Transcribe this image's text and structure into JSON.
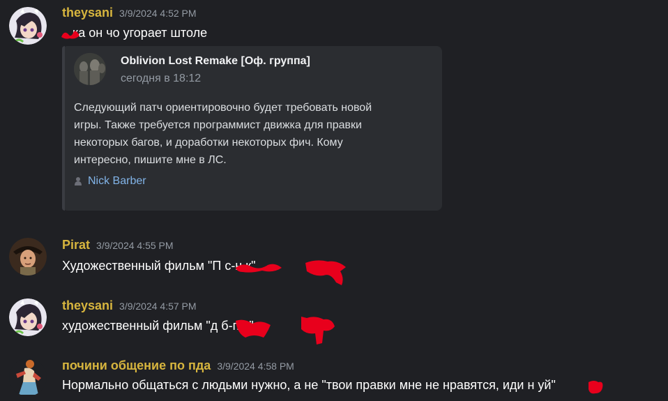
{
  "colors": {
    "background": "#1f2024",
    "username": "#d7b53e",
    "timestamp": "#949ba4",
    "message_text": "#ffffff",
    "embed_bg": "#2b2d31",
    "link": "#82b4e8",
    "redaction": "#e8001c"
  },
  "messages": [
    {
      "username": "theysani",
      "timestamp": "3/9/2024 4:52 PM",
      "text": "ка он чо угорает штоле",
      "embed": {
        "author": "Oblivion Lost Remake [Оф. группа]",
        "subtitle": "сегодня в 18:12",
        "description_lines": [
          "Следующий патч ориентировочно будет требовать новой",
          "игры. Также требуется программист движка для правки",
          "некоторых багов, и доработки некоторых фич. Кому",
          "интересно, пишите мне в ЛС."
        ],
        "footer_icon": "person-icon",
        "footer_name": "Nick Barber"
      }
    },
    {
      "username": "Pirat",
      "timestamp": "3/9/2024 4:55 PM",
      "text": "Художественный фильм \"П              с-н          к\""
    },
    {
      "username": "theysani",
      "timestamp": "3/9/2024 4:57 PM",
      "text": "художественный фильм \"д           б-п          с\""
    },
    {
      "username": "почини общение по пда",
      "timestamp": "3/9/2024 4:58 PM",
      "text": "Нормально общаться с людьми нужно, а не \"твои правки мне не нравятся, иди н     уй\""
    }
  ]
}
